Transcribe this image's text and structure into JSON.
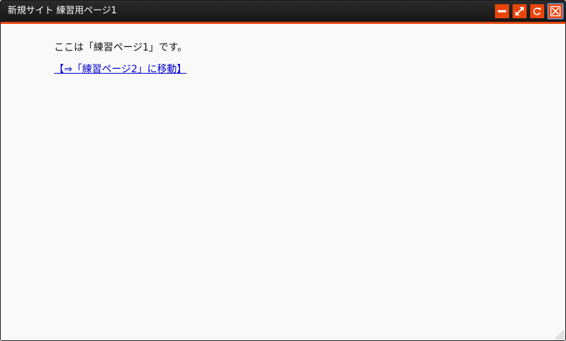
{
  "window": {
    "title": "新規サイト 練習用ページ1",
    "accent_color": "#e0430b",
    "controls": [
      {
        "name": "minimize",
        "icon": "minus-icon"
      },
      {
        "name": "maximize",
        "icon": "expand-icon"
      },
      {
        "name": "reload",
        "icon": "refresh-icon"
      },
      {
        "name": "close",
        "icon": "close-icon"
      }
    ]
  },
  "content": {
    "paragraph": "ここは「練習ページ1」です。",
    "link_text": "【⇒「練習ページ2」に移動】",
    "link_color": "#0000cc"
  }
}
